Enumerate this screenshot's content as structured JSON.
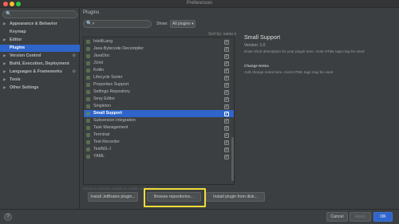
{
  "window": {
    "title": "Preferences"
  },
  "sidebar": {
    "items": [
      {
        "label": "Appearance & Behavior",
        "arrow": "▶",
        "project_icon": ""
      },
      {
        "label": "Keymap",
        "arrow": "",
        "project_icon": ""
      },
      {
        "label": "Editor",
        "arrow": "▶",
        "project_icon": ""
      },
      {
        "label": "Plugins",
        "arrow": "",
        "project_icon": ""
      },
      {
        "label": "Version Control",
        "arrow": "▶",
        "project_icon": "⚙"
      },
      {
        "label": "Build, Execution, Deployment",
        "arrow": "▶",
        "project_icon": ""
      },
      {
        "label": "Languages & Frameworks",
        "arrow": "▶",
        "project_icon": "⚙"
      },
      {
        "label": "Tools",
        "arrow": "▶",
        "project_icon": ""
      },
      {
        "label": "Other Settings",
        "arrow": "▶",
        "project_icon": ""
      }
    ],
    "selected_index": 3
  },
  "content": {
    "title": "Plugins",
    "search_icon": "🔍▾",
    "show_label": "Show:",
    "show_value": "All plugins ▾",
    "sort_label": "Sort by: name ▾"
  },
  "plugins": [
    {
      "name": "IntelliLang",
      "checked": true
    },
    {
      "name": "Java Bytecode Decompiler",
      "checked": true
    },
    {
      "name": "JavaDoc",
      "checked": true
    },
    {
      "name": "JUnit",
      "checked": true
    },
    {
      "name": "Kotlin",
      "checked": true
    },
    {
      "name": "Lifecycle Sorter",
      "checked": true
    },
    {
      "name": "Properties Support",
      "checked": true
    },
    {
      "name": "Settings Repository",
      "checked": true
    },
    {
      "name": "Sexy Editor",
      "checked": true
    },
    {
      "name": "Singleton",
      "checked": true
    },
    {
      "name": "Small Support",
      "checked": true,
      "selected": true
    },
    {
      "name": "Subversion Integration",
      "checked": true
    },
    {
      "name": "Task Management",
      "checked": true
    },
    {
      "name": "Terminal",
      "checked": true
    },
    {
      "name": "Test Recorder",
      "checked": true
    },
    {
      "name": "TestNG-J",
      "checked": true
    },
    {
      "name": "YAML",
      "checked": true
    }
  ],
  "detail": {
    "title": "Small Support",
    "version": "Version: 1.0",
    "description": "Enter short description for your plugin here. most HTML tags may be used",
    "notes_heading": "Change Notes",
    "notes": "Add change notes here. most HTML tags may be used"
  },
  "footer_note": "Check or uncheck a plugin to enable or disable it.",
  "buttons": {
    "install_jetbrains": "Install JetBrains plugin...",
    "browse": "Browse repositories...",
    "install_disk": "Install plugin from disk...",
    "help": "?",
    "cancel": "Cancel",
    "apply": "Apply",
    "ok": "OK"
  },
  "colors": {
    "accent": "#2f65ca",
    "highlight": "#f0dc3a",
    "background": "#3c3f41"
  }
}
